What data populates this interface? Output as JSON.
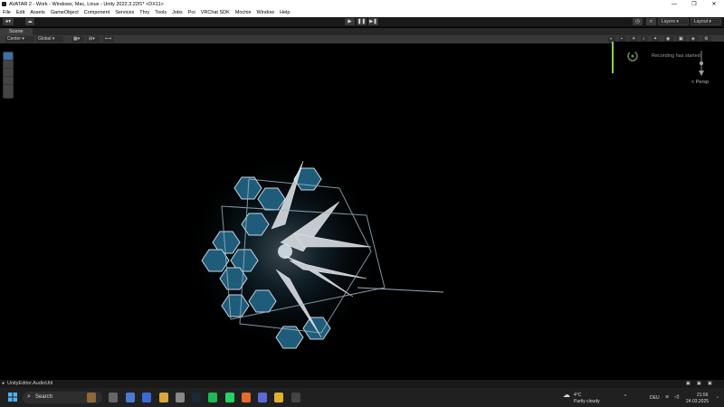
{
  "window": {
    "title": "AVATAR 2 - Work - Windows, Mac, Linux - Unity 2022.3.22f1* <DX11>"
  },
  "menu": [
    "File",
    "Edit",
    "Assets",
    "GameObject",
    "Component",
    "Services",
    "Thry",
    "Tools",
    "Jobs",
    "Poi",
    "VRChat SDK",
    "Mochie",
    "Window",
    "Help"
  ],
  "toolbar": {
    "layers_label": "Layers",
    "layout_label": "Layout"
  },
  "scene": {
    "tab_label": "Scene",
    "pivot_label": "Center",
    "space_label": "Global",
    "persp_label": "Persp"
  },
  "notification": {
    "text": "Recording has started"
  },
  "status": {
    "text": "UnityEditor.AudioUtil"
  },
  "taskbar": {
    "search_label": "Search",
    "weather_temp": "4°C",
    "weather_desc": "Partly cloudy",
    "lang": "DEU",
    "time": "21:56",
    "date": "24.03.2025"
  },
  "colors": {
    "notification_accent": "#8ad04a",
    "editor_bg": "#191919"
  }
}
